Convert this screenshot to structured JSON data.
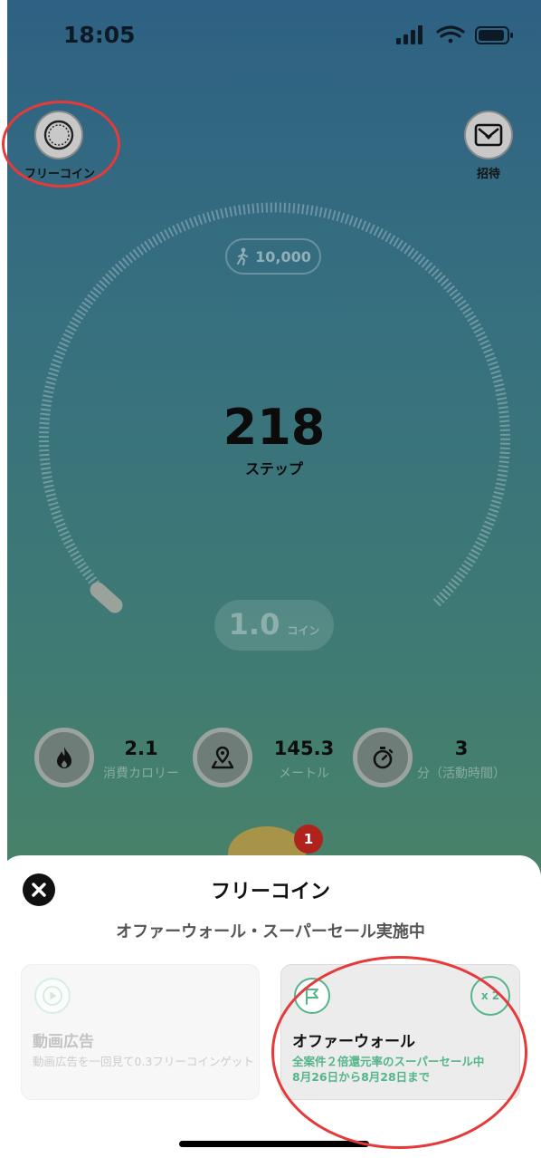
{
  "status": {
    "time": "18:05"
  },
  "top": {
    "free_coin_label": "フリーコイン",
    "invite_label": "招待"
  },
  "gauge": {
    "goal": "10,000",
    "steps": "218",
    "steps_unit": "ステップ",
    "coin_value": "1.0",
    "coin_unit": "コイン"
  },
  "stats": [
    {
      "value": "2.1",
      "label": "消費カロリー",
      "icon": "flame-icon"
    },
    {
      "value": "145.3",
      "label": "メートル",
      "icon": "map-pin-icon"
    },
    {
      "value": "3",
      "label": "分（活動時間）",
      "icon": "stopwatch-icon"
    }
  ],
  "badge_count": "1",
  "sheet": {
    "title": "フリーコイン",
    "subtitle": "オファーウォール・スーパーセール実施中",
    "cards": [
      {
        "title": "動画広告",
        "desc": "動画広告を一回見て0.3フリーコインゲット",
        "icon": "play-icon"
      },
      {
        "title": "オファーウォール",
        "desc_line1": "全案件２倍還元率のスーパーセール中",
        "desc_line2": "8月26日から8月28日まで",
        "icon": "flag-icon",
        "multiplier": "x 2"
      }
    ]
  },
  "colors": {
    "accent_green": "#54b58a",
    "badge_red": "#b0231c",
    "annotation_red": "#e63a3a"
  }
}
